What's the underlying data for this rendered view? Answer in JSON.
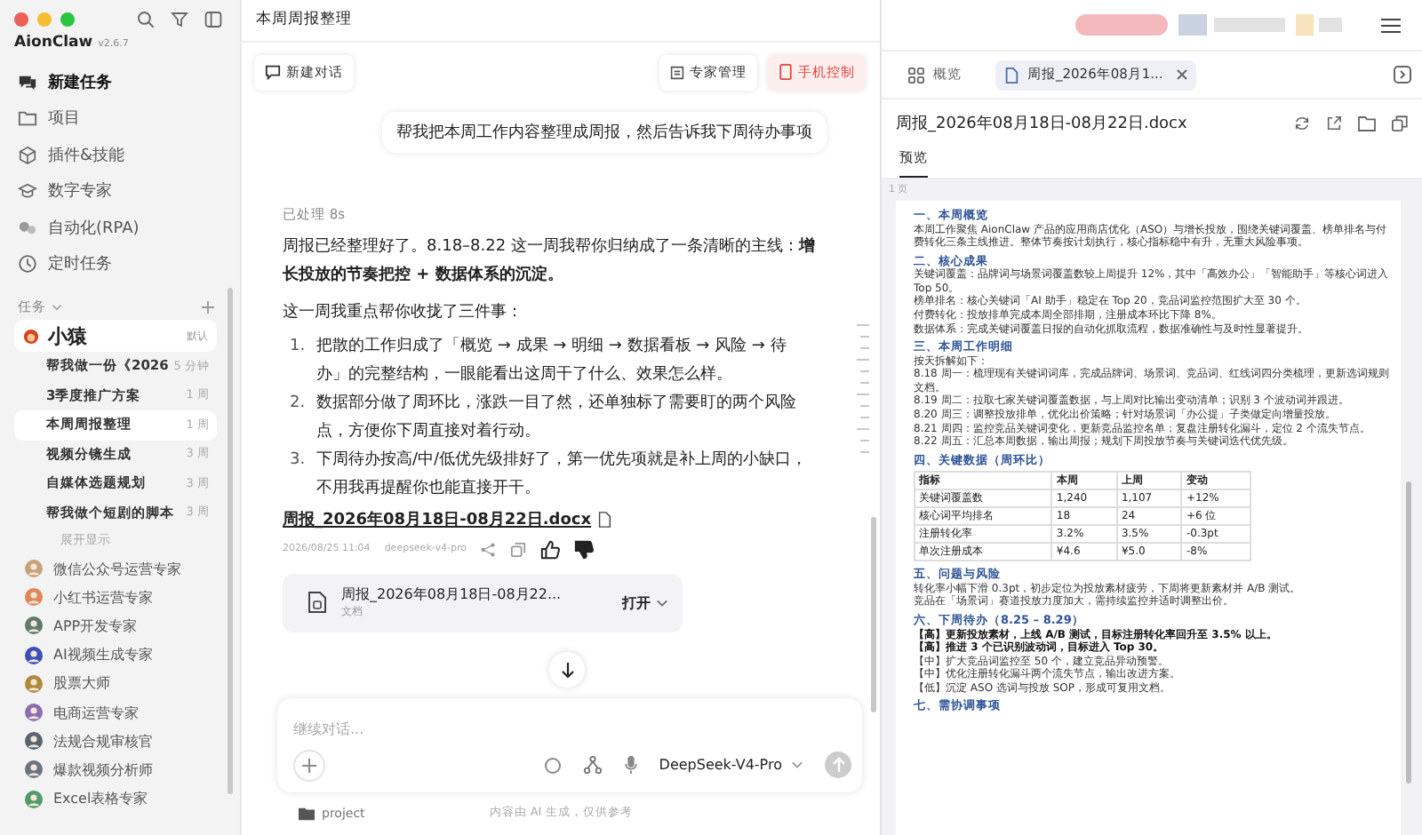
{
  "app": {
    "name": "AionClaw",
    "version": "v2.6.7"
  },
  "nav": [
    {
      "label": "新建任务",
      "kind": "new"
    },
    {
      "label": "项目",
      "kind": "folder"
    },
    {
      "label": "插件&技能",
      "kind": "cube"
    },
    {
      "label": "数字专家",
      "kind": "cap"
    },
    {
      "label": "自动化(RPA)",
      "kind": "auto"
    },
    {
      "label": "定时任务",
      "kind": "clock"
    }
  ],
  "tasks": {
    "title": "任务",
    "group": {
      "name": "小猿",
      "badge": "默认",
      "selected": true
    },
    "items": [
      {
        "title": "帮我做一份《2026",
        "time": "5 分钟",
        "selected": false
      },
      {
        "title": "3季度推广方案",
        "time": "1 周",
        "selected": false
      },
      {
        "title": "本周周报整理",
        "time": "1 周",
        "selected": true
      },
      {
        "title": "视频分镜生成",
        "time": "3 周",
        "selected": false
      },
      {
        "title": "自媒体选题规划",
        "time": "3 周",
        "selected": false
      },
      {
        "title": "帮我做个短剧的脚本",
        "time": "3 周",
        "selected": false
      }
    ],
    "more": "展开显示"
  },
  "experts": [
    {
      "name": "微信公众号运营专家",
      "color": "#c9a27a"
    },
    {
      "name": "小红书运营专家",
      "color": "#e0875a"
    },
    {
      "name": "APP开发专家",
      "color": "#5e7a6a"
    },
    {
      "name": "AI视频生成专家",
      "color": "#3b4fb8"
    },
    {
      "name": "股票大师",
      "color": "#b08a3c"
    },
    {
      "name": "电商运营专家",
      "color": "#8a6fb0"
    },
    {
      "name": "法规合规审核官",
      "color": "#5a6470"
    },
    {
      "name": "爆款视频分析师",
      "color": "#6b7280"
    },
    {
      "name": "Excel表格专家",
      "color": "#4f9a6a"
    }
  ],
  "chat": {
    "title": "本周周报整理",
    "new_chat": "新建对话",
    "expert_manage": "专家管理",
    "phone_control": "手机控制",
    "user_message": "帮我把本周工作内容整理成周报，然后告诉我下周待办事项",
    "processed": "已处理 8s",
    "reply_intro": "周报已经整理好了。8.18–8.22 这一周我帮你归纳成了一条清晰的主线：**增长投放的节奏把控 + 数据体系的沉淀。**",
    "reply_lead": "这一周我重点帮你收拢了三件事：",
    "reply_points": [
      {
        "number": "1.",
        "text": "把散的工作归成了「概览 → 成果 → 明细 → 数据看板 → 风险 → 待办」的完整结构，一眼能看出这周干了什么、效果怎么样。"
      },
      {
        "number": "2.",
        "text": "数据部分做了周环比，涨跌一目了然，还单独标了需要盯的两个风险点，方便你下周直接对着行动。"
      },
      {
        "number": "3.",
        "text": "下周待办按高/中/低优先级排好了，第一优先项就是补上周的小缺口，不用我再提醒你也能直接开干。"
      }
    ],
    "file_link": "周报_2026年08月18日-08月22日.docx",
    "timestamp": "2026/08/25 11:04",
    "model_tag": "deepseek-v4-pro",
    "file_card": {
      "name": "周报_2026年08月18日-08月22...",
      "type": "文档",
      "open": "打开"
    },
    "input": {
      "placeholder": "继续对话...",
      "model": "DeepSeek-V4-Pro"
    },
    "footer": {
      "project": "project",
      "disclaimer": "内容由 AI 生成，仅供参考"
    }
  },
  "preview": {
    "tabs": [
      {
        "label": "概览",
        "kind": "grid",
        "selected": false
      },
      {
        "label": "周报_2026年08月1...",
        "kind": "file",
        "selected": true
      }
    ],
    "file_title": "周报_2026年08月18日-08月22日.docx",
    "view_tab": "预览",
    "page_count": "1 页",
    "sections": [
      {
        "heading": "一、本周概览",
        "blocks": [
          {
            "kind": "text",
            "text": "本周工作聚焦 AionClaw 产品的应用商店优化（ASO）与增长投放，围绕关键词覆盖、榜单排名与付费转化三条主线推进。整体节奏按计划执行，核心指标稳中有升，无重大风险事项。"
          }
        ]
      },
      {
        "heading": "二、核心成果",
        "blocks": [
          {
            "kind": "text",
            "text": "关键词覆盖：品牌词与场景词覆盖数较上周提升 12%，其中「高效办公」「智能助手」等核心词进入 Top 50。"
          },
          {
            "kind": "text",
            "text": "榜单排名：核心关键词「AI 助手」稳定在 Top 20，竞品词监控范围扩大至 30 个。"
          },
          {
            "kind": "text",
            "text": "付费转化：投放排单完成本周全部排期，注册成本环比下降 8%。"
          },
          {
            "kind": "text",
            "text": "数据体系：完成关键词覆盖日报的自动化抓取流程，数据准确性与及时性显著提升。"
          }
        ]
      },
      {
        "heading": "三、本周工作明细",
        "blocks": [
          {
            "kind": "text",
            "text": "按天拆解如下："
          },
          {
            "kind": "text",
            "text": "8.18 周一：梳理现有关键词词库，完成品牌词、场景词、竞品词、红线词四分类梳理，更新选词规则文档。"
          },
          {
            "kind": "text",
            "text": "8.19 周二：拉取七家关键词覆盖数据，与上周对比输出变动清单；识别 3 个波动词并跟进。"
          },
          {
            "kind": "text",
            "text": "8.20 周三：调整投放排单，优化出价策略；针对场景词「办公提」子类做定向增量投放。"
          },
          {
            "kind": "text",
            "text": "8.21 周四：监控竞品关键词变化，更新竞品监控名单；复盘注册转化漏斗，定位 2 个流失节点。"
          },
          {
            "kind": "text",
            "text": "8.22 周五：汇总本周数据，输出周报；规划下周投放节奏与关键词迭代优先级。"
          }
        ]
      },
      {
        "heading": "四、关键数据（周环比）",
        "blocks": [
          {
            "kind": "table",
            "header": [
              "指标",
              "本周",
              "上周",
              "变动"
            ],
            "rows": [
              [
                "关键词覆盖数",
                "1,240",
                "1,107",
                "+12%"
              ],
              [
                "核心词平均排名",
                "18",
                "24",
                "+6 位"
              ],
              [
                "注册转化率",
                "3.2%",
                "3.5%",
                "-0.3pt"
              ],
              [
                "单次注册成本",
                "¥4.6",
                "¥5.0",
                "-8%"
              ]
            ]
          }
        ]
      },
      {
        "heading": "五、问题与风险",
        "blocks": [
          {
            "kind": "text",
            "text": "转化率小幅下滑 0.3pt，初步定位为投放素材疲劳，下周将更新素材并 A/B 测试。"
          },
          {
            "kind": "text",
            "text": "竞品在「场景词」赛道投放力度加大，需持续监控并适时调整出价。"
          }
        ]
      },
      {
        "heading": "六、下周待办（8.25 – 8.29）",
        "blocks": [
          {
            "kind": "todo",
            "text": "【高】更新投放素材，上线 A/B 测试，目标注册转化率回升至 3.5% 以上。"
          },
          {
            "kind": "todo",
            "text": "【高】推进 3 个已识别波动词，目标进入 Top 30。"
          },
          {
            "kind": "text",
            "text": "【中】扩大竞品词监控至 50 个，建立竞品异动预警。"
          },
          {
            "kind": "text",
            "text": "【中】优化注册转化漏斗两个流失节点，输出改进方案。"
          },
          {
            "kind": "text",
            "text": "【低】沉淀 ASO 选词与投放 SOP，形成可复用文档。"
          }
        ]
      },
      {
        "heading": "七、需协调事项"
      }
    ]
  }
}
